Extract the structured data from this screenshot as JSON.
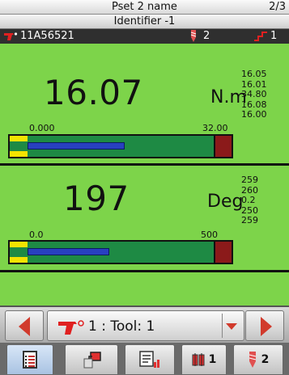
{
  "header": {
    "pset_name": "Pset 2 name",
    "page_indicator": "2/3",
    "identifier": "Identifier -1"
  },
  "status": {
    "tool_serial": "11A56521",
    "bit_count": "2",
    "step_count": "1"
  },
  "torque": {
    "value": "16.07",
    "unit": "N.m",
    "stats": [
      "16.05",
      "16.01",
      "34.80",
      "16.08",
      "16.00"
    ],
    "scale_min": "0.000",
    "scale_max": "32.00",
    "fill_fraction": 0.52
  },
  "angle": {
    "value": "197",
    "unit": "Deg",
    "stats": [
      "259",
      "260",
      "0.2",
      "250",
      "259"
    ],
    "scale_min": "0.0",
    "scale_max": "500",
    "fill_fraction": 0.44
  },
  "tool_selector": {
    "label": "1 : Tool: 1"
  },
  "tabs": [
    {
      "name": "results",
      "label": ""
    },
    {
      "name": "tool-pset",
      "label": ""
    },
    {
      "name": "report",
      "label": ""
    },
    {
      "name": "batch",
      "label": "1"
    },
    {
      "name": "bits",
      "label": "2"
    }
  ],
  "colors": {
    "panel_green": "#7dd44a",
    "bar_green": "#1e8a44",
    "accent_red": "#d13a2c",
    "bar_blue": "#2840c0",
    "limit_yellow": "#f4e300"
  },
  "icons": [
    "tool-icon",
    "bit-icon",
    "step-icon",
    "arrow-left-icon",
    "arrow-right-icon",
    "dropdown-icon",
    "results-icon",
    "tool-pset-icon",
    "report-icon",
    "batch-icon",
    "bits-icon"
  ]
}
